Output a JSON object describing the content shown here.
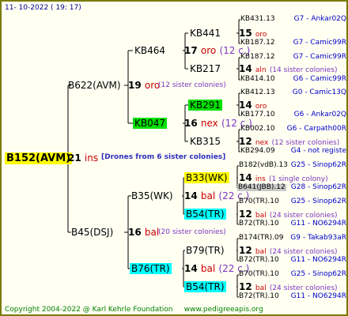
{
  "header": {
    "date": "11- 10-2022 ( 19: 17)"
  },
  "footer": {
    "copyright": "Copyright 2004-2022 @ Karl Kehrle Foundation",
    "site": "www.pedigreeapis.org"
  },
  "root": {
    "id": "B152(AVM)",
    "num": "21",
    "ins": "ins",
    "note": "[Drones from 6 sister colonies]"
  },
  "g1": [
    {
      "id": "B622(AVM)",
      "num": "19",
      "ins": "oro",
      "note": "(12 sister colonies)"
    },
    {
      "id": "B45(DSJ)",
      "num": "16",
      "ins": "bal",
      "note": "(20 sister colonies)"
    }
  ],
  "g2": [
    {
      "id": "KB464",
      "num": "17",
      "ins": "oro",
      "note": "(12 c.)"
    },
    {
      "id": "KB047",
      "num": "16",
      "ins": "nex",
      "note": "(12 c.)"
    },
    {
      "id": "B35(WK)",
      "num": "14",
      "ins": "bal",
      "note": "(22 c.)"
    },
    {
      "id": "B76(TR)",
      "num": "14",
      "ins": "bal",
      "note": "(22 c.)"
    }
  ],
  "g3": [
    {
      "id": "KB441",
      "num": "15",
      "ins": "oro",
      "note": ""
    },
    {
      "id": "KB217",
      "num": "14",
      "ins": "aln",
      "note": "(14 sister colonies)"
    },
    {
      "id": "KB291",
      "num": "14",
      "ins": "oro",
      "note": ""
    },
    {
      "id": "KB315",
      "num": "12",
      "ins": "nex",
      "note": "(12 sister colonies)"
    },
    {
      "id": "B33(WK)",
      "num": "14",
      "ins": "ins",
      "note": "(1 single colony)"
    },
    {
      "id": "B54(TR)",
      "num": "12",
      "ins": "bal",
      "note": "(24 sister colonies)"
    },
    {
      "id": "B79(TR)",
      "num": "12",
      "ins": "bal",
      "note": "(24 sister colonies)"
    },
    {
      "id": "B54(TR)",
      "num": "12",
      "ins": "bal",
      "note": "(24 sister colonies)"
    }
  ],
  "g4": [
    {
      "id": "KB431.13",
      "src": "G7 - Ankar02Q"
    },
    {
      "id": "KB187.12",
      "src": "G7 - Camic99R"
    },
    {
      "id": "KB187.12",
      "src": "G7 - Camic99R"
    },
    {
      "id": "KB414.10",
      "src": "G6 - Camic99R"
    },
    {
      "id": "KB412.13",
      "src": "G0 - Camic13Q"
    },
    {
      "id": "KB177.10",
      "src": "G6 - Ankar02Q"
    },
    {
      "id": "KB002.10",
      "src": "G6 - Carpath00R"
    },
    {
      "id": "KB294.09",
      "src": "G4 - not registe"
    },
    {
      "id": "B182(vdB).13",
      "src": "G25 - Sinop62R"
    },
    {
      "id": "B641(JBB).12",
      "src": "G28 - Sinop62R"
    },
    {
      "id": "B70(TR).10",
      "src": "G25 - Sinop62R"
    },
    {
      "id": "B72(TR).10",
      "src": "G11 - NO6294R"
    },
    {
      "id": "B174(TR).09",
      "src": "G9 - Takab93aR"
    },
    {
      "id": "B72(TR).10",
      "src": "G11 - NO6294R"
    },
    {
      "id": "B70(TR).10",
      "src": "G25 - Sinop62R"
    },
    {
      "id": "B72(TR).10",
      "src": "G11 - NO6294R"
    }
  ]
}
